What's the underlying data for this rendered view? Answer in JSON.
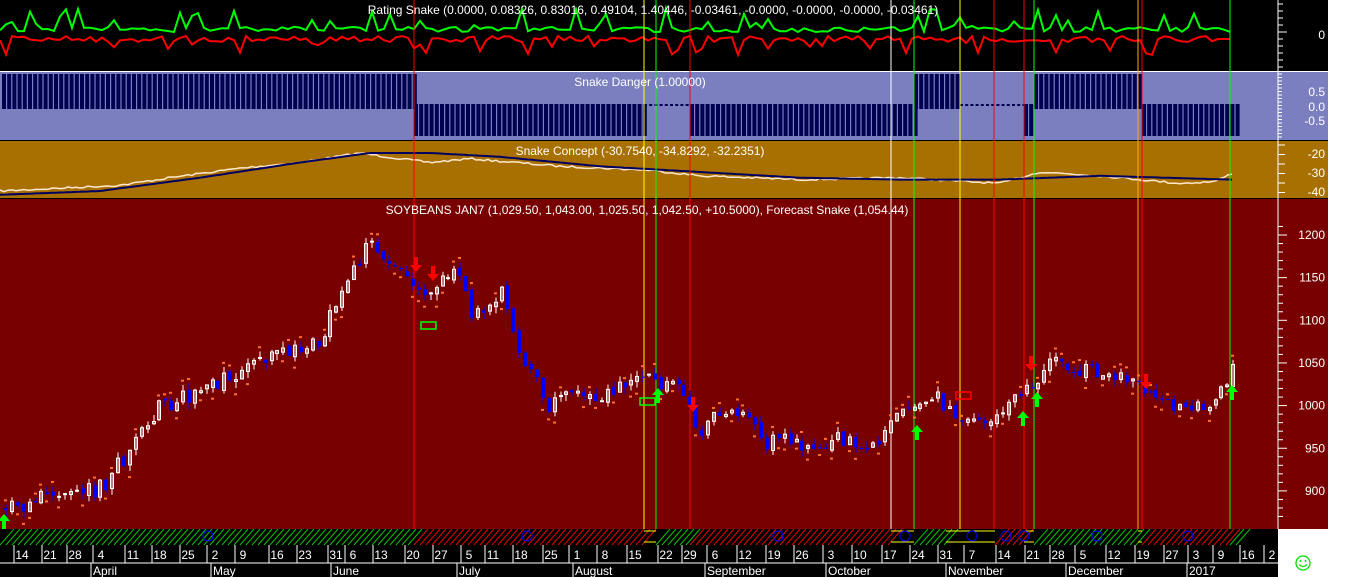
{
  "panels": {
    "rating": {
      "title": "Rating Snake (0.0000, 0.08326, 0.83016, 0.49104, 1.40446, -0.03461, -0.0000, -0.0000, -0.0000, -0.03461)",
      "ticks": [
        "0"
      ]
    },
    "danger": {
      "title": "Snake Danger (1.00000)",
      "ticks": [
        "0.5",
        "0.0",
        "-0.5"
      ]
    },
    "concept": {
      "title": "Snake Concept (-30.7540, -34.8292, -32.2351)",
      "ticks": [
        "-20",
        "-30",
        "-40"
      ]
    },
    "main": {
      "title": "SOYBEANS JAN7 (1,029.50, 1,043.00, 1,025.50, 1,042.50, +10.5000), Forecast Snake (1,054.44)",
      "ticks": [
        "1200",
        "1150",
        "1100",
        "1050",
        "1000",
        "950",
        "900"
      ]
    }
  },
  "date_labels": [
    "14",
    "21",
    "28",
    "4",
    "11",
    "18",
    "25",
    "2",
    "9",
    "16",
    "23",
    "31",
    "6",
    "13",
    "20",
    "27",
    "5",
    "11",
    "18",
    "25",
    "1",
    "8",
    "15",
    "22",
    "29",
    "6",
    "12",
    "19",
    "26",
    "3",
    "10",
    "17",
    "24",
    "31",
    "7",
    "14",
    "21",
    "28",
    "5",
    "12",
    "19",
    "27",
    "3",
    "9",
    "16",
    "2"
  ],
  "month_labels": [
    "April",
    "May",
    "June",
    "July",
    "August",
    "September",
    "October",
    "November",
    "December",
    "2017"
  ],
  "status_icon": "smiley-icon",
  "colors": {
    "main_bg": "#780000",
    "danger_bg": "#7b7fc0",
    "concept_bg": "#a87000",
    "up": "#00ff00",
    "down": "#ff0000",
    "bear_candle": "#0000ff"
  },
  "chart_data": {
    "type": "candlestick",
    "title": "SOYBEANS JAN7",
    "ylim": [
      860,
      1240
    ],
    "last_bar": {
      "open": 1029.5,
      "high": 1043.0,
      "low": 1025.5,
      "close": 1042.5,
      "change": 10.5
    },
    "forecast_snake": 1054.44,
    "approx_weekly_close": {
      "x": [
        "Mar 14",
        "Apr 4",
        "Apr 18",
        "May 2",
        "May 16",
        "May 31",
        "Jun 13",
        "Jun 27",
        "Jul 11",
        "Jul 25",
        "Aug 8",
        "Aug 22",
        "Sep 6",
        "Sep 19",
        "Oct 3",
        "Oct 17",
        "Oct 31",
        "Nov 14",
        "Nov 28",
        "Dec 12",
        "Dec 27",
        "Jan 9"
      ],
      "values": [
        880,
        905,
        960,
        1020,
        1050,
        1090,
        1190,
        1130,
        1120,
        1040,
        1010,
        1030,
        975,
        960,
        955,
        990,
        995,
        990,
        1045,
        1040,
        1010,
        1042.5
      ]
    }
  }
}
